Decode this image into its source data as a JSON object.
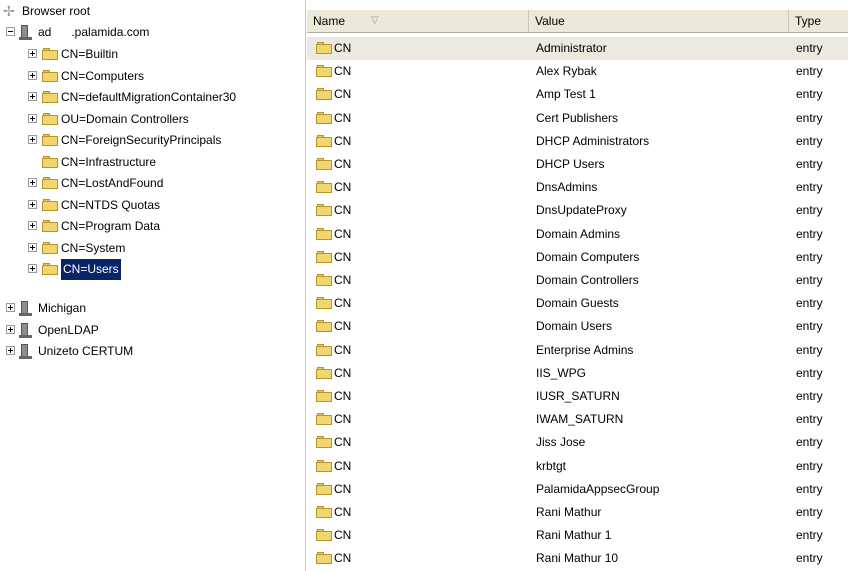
{
  "tree": {
    "root_label": "Browser root",
    "connection_label": "ad      .palamida.com",
    "children": [
      {
        "label": "CN=Builtin",
        "expandable": true
      },
      {
        "label": "CN=Computers",
        "expandable": true
      },
      {
        "label": "CN=defaultMigrationContainer30",
        "expandable": true
      },
      {
        "label": "OU=Domain Controllers",
        "expandable": true
      },
      {
        "label": "CN=ForeignSecurityPrincipals",
        "expandable": true
      },
      {
        "label": "CN=Infrastructure",
        "expandable": false
      },
      {
        "label": "CN=LostAndFound",
        "expandable": true
      },
      {
        "label": "CN=NTDS Quotas",
        "expandable": true
      },
      {
        "label": "CN=Program Data",
        "expandable": true
      },
      {
        "label": "CN=System",
        "expandable": true
      },
      {
        "label": "CN=Users",
        "expandable": true,
        "selected": true
      }
    ],
    "other_connections": [
      "Michigan",
      "OpenLDAP",
      "Unizeto CERTUM"
    ]
  },
  "list": {
    "columns": {
      "name": "Name",
      "value": "Value",
      "type": "Type"
    },
    "rows": [
      {
        "name": "CN",
        "value": "Administrator",
        "type": "entry"
      },
      {
        "name": "CN",
        "value": "Alex Rybak",
        "type": "entry"
      },
      {
        "name": "CN",
        "value": "Amp Test 1",
        "type": "entry"
      },
      {
        "name": "CN",
        "value": "Cert Publishers",
        "type": "entry"
      },
      {
        "name": "CN",
        "value": "DHCP Administrators",
        "type": "entry"
      },
      {
        "name": "CN",
        "value": "DHCP Users",
        "type": "entry"
      },
      {
        "name": "CN",
        "value": "DnsAdmins",
        "type": "entry"
      },
      {
        "name": "CN",
        "value": "DnsUpdateProxy",
        "type": "entry"
      },
      {
        "name": "CN",
        "value": "Domain Admins",
        "type": "entry"
      },
      {
        "name": "CN",
        "value": "Domain Computers",
        "type": "entry"
      },
      {
        "name": "CN",
        "value": "Domain Controllers",
        "type": "entry"
      },
      {
        "name": "CN",
        "value": "Domain Guests",
        "type": "entry"
      },
      {
        "name": "CN",
        "value": "Domain Users",
        "type": "entry"
      },
      {
        "name": "CN",
        "value": "Enterprise Admins",
        "type": "entry"
      },
      {
        "name": "CN",
        "value": "IIS_WPG",
        "type": "entry"
      },
      {
        "name": "CN",
        "value": "IUSR_SATURN",
        "type": "entry"
      },
      {
        "name": "CN",
        "value": "IWAM_SATURN",
        "type": "entry"
      },
      {
        "name": "CN",
        "value": "Jiss Jose",
        "type": "entry"
      },
      {
        "name": "CN",
        "value": "krbtgt",
        "type": "entry"
      },
      {
        "name": "CN",
        "value": "PalamidaAppsecGroup",
        "type": "entry"
      },
      {
        "name": "CN",
        "value": "Rani Mathur",
        "type": "entry"
      },
      {
        "name": "CN",
        "value": "Rani Mathur 1",
        "type": "entry"
      },
      {
        "name": "CN",
        "value": "Rani Mathur 10",
        "type": "entry"
      }
    ]
  },
  "colors": {
    "selection": "#0a246a",
    "header_bg": "#ece9d8",
    "folder": "#f1d56e",
    "highlight_row": "#ece9e0"
  }
}
